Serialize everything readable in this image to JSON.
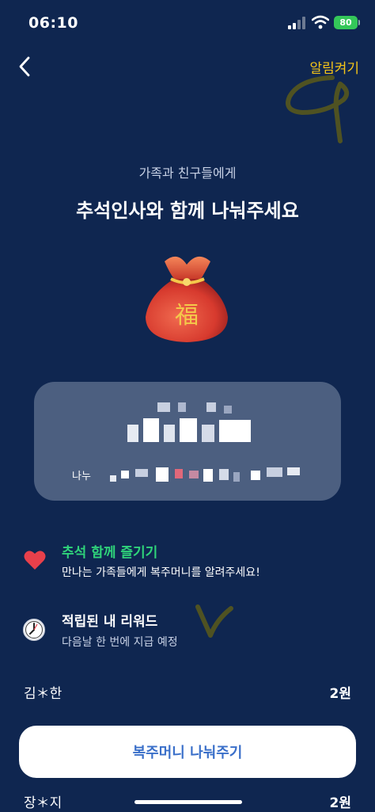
{
  "status_bar": {
    "time": "06:10",
    "battery": "80"
  },
  "header": {
    "back_icon": "chevron-left-icon",
    "notify_label": "알림켜기"
  },
  "hero": {
    "subtitle": "가족과 친구들에게",
    "title": "추석인사와 함께 나눠주세요",
    "image_icon": "lucky-pouch-icon"
  },
  "card": {
    "share_label": "나누"
  },
  "features": [
    {
      "icon": "heart-icon",
      "title": "추석 함께 즐기기",
      "description": "만나는 가족들에게 복주머니를 알려주세요!",
      "title_color": "#2fd27a"
    },
    {
      "icon": "clock-icon",
      "title": "적립된 내 리워드",
      "description": "다음날 한 번에 지급 예정",
      "title_color": "#ffffff"
    }
  ],
  "rewards_list": [
    {
      "name": "김＊한",
      "amount": "2원"
    },
    {
      "name": "장＊지",
      "amount": "2원"
    }
  ],
  "cta": {
    "label": "복주머니 나눠주기"
  },
  "colors": {
    "background": "#0f2650",
    "card": "#4c5f80",
    "accent_yellow": "#f5c518",
    "accent_green": "#2fd27a",
    "button_text": "#3a6fc9"
  }
}
